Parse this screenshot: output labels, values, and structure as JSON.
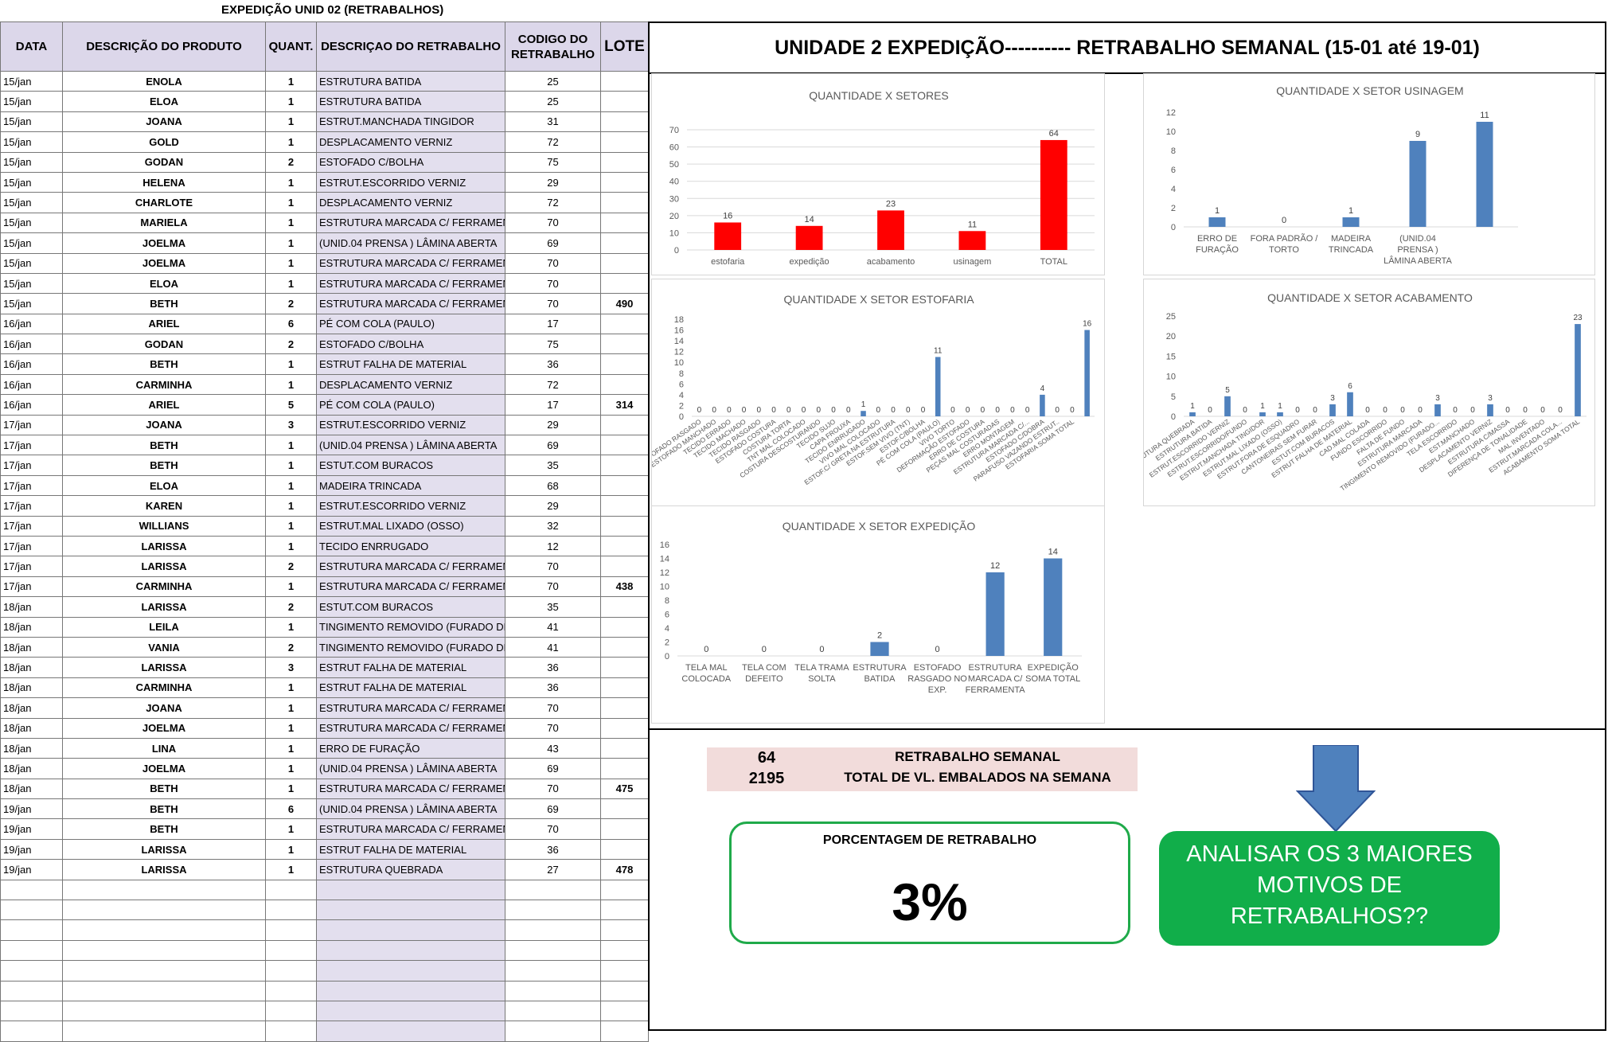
{
  "sheet": {
    "title": "EXPEDIÇÃO UNID 02 (RETRABALHOS)",
    "headers": [
      "DATA",
      "DESCRIÇÃO DO PRODUTO",
      "QUANT.",
      "DESCRIÇAO DO RETRABALHO",
      "CODIGO DO RETRABALHO",
      "LOTE"
    ],
    "rows": [
      [
        "15/jan",
        "ENOLA",
        "1",
        "ESTRUTURA BATIDA",
        "25",
        ""
      ],
      [
        "15/jan",
        "ELOA",
        "1",
        "ESTRUTURA BATIDA",
        "25",
        ""
      ],
      [
        "15/jan",
        "JOANA",
        "1",
        "ESTRUT.MANCHADA TINGIDOR",
        "31",
        ""
      ],
      [
        "15/jan",
        "GOLD",
        "1",
        "DESPLACAMENTO VERNIZ",
        "72",
        ""
      ],
      [
        "15/jan",
        "GODAN",
        "2",
        "ESTOFADO C/BOLHA",
        "75",
        ""
      ],
      [
        "15/jan",
        "HELENA",
        "1",
        "ESTRUT.ESCORRIDO VERNIZ",
        "29",
        ""
      ],
      [
        "15/jan",
        "CHARLOTE",
        "1",
        "DESPLACAMENTO VERNIZ",
        "72",
        ""
      ],
      [
        "15/jan",
        "MARIELA",
        "1",
        "ESTRUTURA MARCADA C/ FERRAMENTA",
        "70",
        ""
      ],
      [
        "15/jan",
        "JOELMA",
        "1",
        "(UNID.04 PRENSA ) LÂMINA ABERTA",
        "69",
        ""
      ],
      [
        "15/jan",
        "JOELMA",
        "1",
        "ESTRUTURA MARCADA C/ FERRAMENTA",
        "70",
        ""
      ],
      [
        "15/jan",
        "ELOA",
        "1",
        "ESTRUTURA MARCADA C/ FERRAMENTA",
        "70",
        ""
      ],
      [
        "15/jan",
        "BETH",
        "2",
        "ESTRUTURA MARCADA C/ FERRAMENTA",
        "70",
        "490"
      ],
      [
        "16/jan",
        "ARIEL",
        "6",
        "PÉ COM COLA (PAULO)",
        "17",
        ""
      ],
      [
        "16/jan",
        "GODAN",
        "2",
        "ESTOFADO C/BOLHA",
        "75",
        ""
      ],
      [
        "16/jan",
        "BETH",
        "1",
        "ESTRUT FALHA DE MATERIAL",
        "36",
        ""
      ],
      [
        "16/jan",
        "CARMINHA",
        "1",
        "DESPLACAMENTO VERNIZ",
        "72",
        ""
      ],
      [
        "16/jan",
        "ARIEL",
        "5",
        "PÉ COM COLA (PAULO)",
        "17",
        "314"
      ],
      [
        "17/jan",
        "JOANA",
        "3",
        "ESTRUT.ESCORRIDO VERNIZ",
        "29",
        ""
      ],
      [
        "17/jan",
        "BETH",
        "1",
        "(UNID.04 PRENSA ) LÂMINA ABERTA",
        "69",
        ""
      ],
      [
        "17/jan",
        "BETH",
        "1",
        "ESTUT.COM BURACOS",
        "35",
        ""
      ],
      [
        "17/jan",
        "ELOA",
        "1",
        "MADEIRA TRINCADA",
        "68",
        ""
      ],
      [
        "17/jan",
        "KAREN",
        "1",
        "ESTRUT.ESCORRIDO VERNIZ",
        "29",
        ""
      ],
      [
        "17/jan",
        "WILLIANS",
        "1",
        "ESTRUT.MAL LIXADO (OSSO)",
        "32",
        ""
      ],
      [
        "17/jan",
        "LARISSA",
        "1",
        "TECIDO ENRRUGADO",
        "12",
        ""
      ],
      [
        "17/jan",
        "LARISSA",
        "2",
        "ESTRUTURA MARCADA C/ FERRAMENTA",
        "70",
        ""
      ],
      [
        "17/jan",
        "CARMINHA",
        "1",
        "ESTRUTURA MARCADA C/ FERRAMENTA",
        "70",
        "438"
      ],
      [
        "18/jan",
        "LARISSA",
        "2",
        "ESTUT.COM BURACOS",
        "35",
        ""
      ],
      [
        "18/jan",
        "LEILA",
        "1",
        "TINGIMENTO REMOVIDO (FURADO DE",
        "41",
        ""
      ],
      [
        "18/jan",
        "VANIA",
        "2",
        "TINGIMENTO REMOVIDO (FURADO DE",
        "41",
        ""
      ],
      [
        "18/jan",
        "LARISSA",
        "3",
        "ESTRUT FALHA DE MATERIAL",
        "36",
        ""
      ],
      [
        "18/jan",
        "CARMINHA",
        "1",
        "ESTRUT FALHA DE MATERIAL",
        "36",
        ""
      ],
      [
        "18/jan",
        "JOANA",
        "1",
        "ESTRUTURA MARCADA C/ FERRAMENTA",
        "70",
        ""
      ],
      [
        "18/jan",
        "JOELMA",
        "1",
        "ESTRUTURA MARCADA C/ FERRAMENTA",
        "70",
        ""
      ],
      [
        "18/jan",
        "LINA",
        "1",
        "ERRO DE FURAÇÃO",
        "43",
        ""
      ],
      [
        "18/jan",
        "JOELMA",
        "1",
        "(UNID.04 PRENSA ) LÂMINA ABERTA",
        "69",
        ""
      ],
      [
        "18/jan",
        "BETH",
        "1",
        "ESTRUTURA MARCADA C/ FERRAMENTA",
        "70",
        "475"
      ],
      [
        "19/jan",
        "BETH",
        "6",
        "(UNID.04 PRENSA ) LÂMINA ABERTA",
        "69",
        ""
      ],
      [
        "19/jan",
        "BETH",
        "1",
        "ESTRUTURA MARCADA C/ FERRAMENTA",
        "70",
        ""
      ],
      [
        "19/jan",
        "LARISSA",
        "1",
        "ESTRUT FALHA DE MATERIAL",
        "36",
        ""
      ],
      [
        "19/jan",
        "LARISSA",
        "1",
        "ESTRUTURA QUEBRADA",
        "27",
        "478"
      ]
    ],
    "empty_rows": 8
  },
  "dashboard": {
    "title": "UNIDADE 2 EXPEDIÇÃO----------   RETRABALHO SEMANAL (15-01 até 19-01)"
  },
  "summary": {
    "weekly_value": "64",
    "weekly_label": "RETRABALHO SEMANAL",
    "packed_value": "2195",
    "packed_label": "TOTAL DE VL. EMBALADOS NA SEMANA",
    "pct_label": "PORCENTAGEM DE RETRABALHO",
    "pct_value": "3%",
    "cta_lines": [
      "ANALISAR OS 3 MAIORES",
      "MOTIVOS DE",
      "RETRABALHOS??"
    ]
  },
  "colors": {
    "red_bar": "#ff0000",
    "blue_bar": "#4f81bd",
    "green": "#11ae4a",
    "summary_bg": "#f2dcdb"
  },
  "chart_data": [
    {
      "type": "bar",
      "title": "QUANTIDADE X SETORES",
      "categories": [
        "estofaria",
        "expedição",
        "acabamento",
        "usinagem",
        "TOTAL"
      ],
      "values": [
        16,
        14,
        23,
        11,
        64
      ],
      "ylim": [
        0,
        70
      ],
      "yticks": [
        0,
        10,
        20,
        30,
        40,
        50,
        60,
        70
      ],
      "color": "#ff0000",
      "grid": true
    },
    {
      "type": "bar",
      "title": "QUANTIDADE X SETOR USINAGEM",
      "categories": [
        "ERRO DE FURAÇÃO",
        "FORA PADRÃO / TORTO",
        "MADEIRA TRINCADA",
        "(UNID.04 PRENSA ) LÂMINA ABERTA",
        ""
      ],
      "values": [
        1,
        0,
        1,
        9,
        11
      ],
      "ylim": [
        0,
        12
      ],
      "yticks": [
        0,
        2,
        4,
        6,
        8,
        10,
        12
      ],
      "color": "#4f81bd",
      "grid": false
    },
    {
      "type": "bar",
      "title": "QUANTIDADE X SETOR ESTOFARIA",
      "categories": [
        "ESTOFADO RASGADO",
        "ESTOFADO MANCHADO",
        "TECIDO ERRADO",
        "TECIDO MACHADO",
        "TECIDO RASGADO",
        "ESTOFADO COSTURA",
        "COSTURA TORTA",
        "TNT MAL COLOCADO",
        "COSTURA DESCOSTURANDO",
        "TECIDO SUJO",
        "CAPA FROUXA",
        "TECIDO ENRRUGADO",
        "VIVO MAL COLOCADO",
        "ESTOF.C/ GRETA NA ESTRUTURA",
        "ESTOF.SEM VIVO (TNT)",
        "ESTOF.C/BOLHA",
        "PÉ COM COLA (PAULO)",
        "VIVO TORTO",
        "DEFORMAÇÃO ESTOFADO",
        "ERRO DE COSTURA",
        "PEÇAS MAL COSTURADAS",
        "ERRO MONTAGEM",
        "ESTRUTURA MARCADA C/...",
        "ESTOFADO C/DOBRA",
        "PARAFUSO VAZANDO ESTRUT..",
        "ESTOFARIA SOMA TOTAL"
      ],
      "values": [
        0,
        0,
        0,
        0,
        0,
        0,
        0,
        0,
        0,
        0,
        0,
        1,
        0,
        0,
        0,
        0,
        11,
        0,
        0,
        0,
        0,
        0,
        0,
        4,
        0,
        0,
        16
      ],
      "ylim": [
        0,
        18
      ],
      "yticks": [
        0,
        2,
        4,
        6,
        8,
        10,
        12,
        14,
        16,
        18
      ],
      "color": "#4f81bd",
      "grid": false
    },
    {
      "type": "bar",
      "title": "QUANTIDADE X SETOR ACABAMENTO",
      "categories": [
        "ESTRUTURA QUEBRADA",
        "ESTRUTURA BATIDA",
        "ESTRUT.ESCORRIDO VERNIZ",
        "ESTRUT.ESCORRIDO/FUNDO",
        "ESTRUT.MANCHADA TINGIDOR",
        "ESTRUT.MAL LIXADO (OSSO)",
        "ESTRUT.FORA DE ESQUADRO",
        "CANTONEIRAS SEM FURAR",
        "ESTUT.COM BURACOS",
        "ESTRUT FALHA DE MATERIAL",
        "CAD.MAL COLADA",
        "FUNDO ESCORRIDO",
        "FALTA DE FUNDO",
        "ESTRUTURA MARCADA",
        "TINGIMENTO REMOVIDO (FURADO...",
        "TELA ESCORRIDO",
        "EST.MANCHADO",
        "DESPLACAMENTO VERNIZ",
        "ESTRUTURA C/MASSA",
        "DIFERENÇA DE TONALIDADE",
        "MAL INVENTADO",
        "ESTRUT.MARCADA COLA...",
        "ACABAMENTO SOMA TOTAL"
      ],
      "values": [
        1,
        0,
        5,
        0,
        1,
        1,
        0,
        0,
        3,
        6,
        0,
        0,
        0,
        0,
        3,
        0,
        0,
        3,
        0,
        0,
        0,
        0,
        23
      ],
      "ylim": [
        0,
        25
      ],
      "yticks": [
        0,
        5,
        10,
        15,
        20,
        25
      ],
      "color": "#4f81bd",
      "grid": false
    },
    {
      "type": "bar",
      "title": "QUANTIDADE X SETOR EXPEDIÇÃO",
      "categories": [
        "TELA MAL COLOCADA",
        "TELA COM DEFEITO",
        "TELA TRAMA SOLTA",
        "ESTRUTURA BATIDA",
        "ESTOFADO RASGADO NO EXP.",
        "ESTRUTURA MARCADA C/ FERRAMENTA",
        "EXPEDIÇÃO SOMA TOTAL"
      ],
      "values": [
        0,
        0,
        0,
        2,
        0,
        12,
        14
      ],
      "ylim": [
        0,
        16
      ],
      "yticks": [
        0,
        2,
        4,
        6,
        8,
        10,
        12,
        14,
        16
      ],
      "color": "#4f81bd",
      "grid": false
    }
  ]
}
